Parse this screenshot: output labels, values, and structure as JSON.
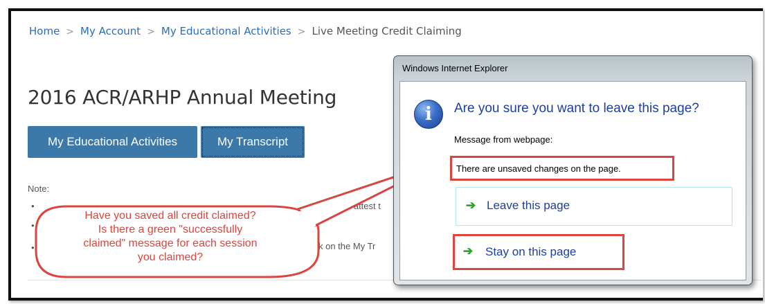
{
  "breadcrumb": {
    "items": [
      "Home",
      "My Account",
      "My Educational Activities"
    ],
    "current": "Live Meeting Credit Claiming"
  },
  "page": {
    "title": "2016 ACR/ARHP Annual Meeting",
    "buttons": {
      "activities": "My Educational Activities",
      "transcript": "My Transcript"
    },
    "note_label": "Note:",
    "bullets": [
      "•",
      "•",
      "•"
    ],
    "fragments": [
      "u attest t",
      "k on the My Tr"
    ]
  },
  "dialog": {
    "title": "Windows Internet Explorer",
    "question": "Are you sure you want to leave this page?",
    "from_label": "Message from webpage:",
    "message": "There are unsaved changes on the page.",
    "leave_label": "Leave this page",
    "stay_label": "Stay on this page",
    "icon": "info-icon",
    "arrow_icon": "green-arrow-icon"
  },
  "callout": {
    "line1": "Have you saved all credit claimed?",
    "line2": "Is there a green \"successfully",
    "line3": "claimed\" message for each session",
    "line4": "you claimed?"
  },
  "colors": {
    "link": "#2a6eb8",
    "button": "#3d79a8",
    "highlight": "#d9453f",
    "dialog_text": "#1b3f9e"
  }
}
